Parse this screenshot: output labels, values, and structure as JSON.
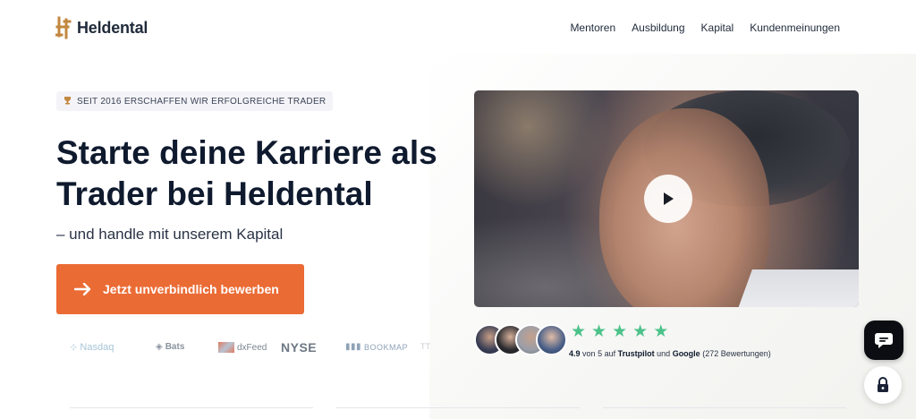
{
  "brand": {
    "name": "Heldental",
    "accent": "#eb6b34",
    "logo_color": "#c2873f"
  },
  "nav": {
    "items": [
      {
        "label": "Mentoren"
      },
      {
        "label": "Ausbildung"
      },
      {
        "label": "Kapital"
      },
      {
        "label": "Kundenmeinungen"
      }
    ]
  },
  "hero": {
    "badge_icon": "trophy-icon",
    "badge_text": "SEIT 2016 ERSCHAFFEN WIR ERFOLGREICHE TRADER",
    "title": "Starte deine Karriere als Trader bei Heldental",
    "subtitle": "– und handle mit unserem Kapital",
    "cta_label": "Jetzt unverbindlich bewerben",
    "cta_icon": "arrow-right-icon"
  },
  "partners": [
    {
      "name": "Nasdaq"
    },
    {
      "name": "Bats"
    },
    {
      "name": "dxFeed"
    },
    {
      "name": "NYSE"
    },
    {
      "name": "BOOKMAP"
    },
    {
      "name": "TT"
    }
  ],
  "video": {
    "play_icon": "play-icon"
  },
  "reviews": {
    "stars": 5,
    "star_color": "#4cc28a",
    "score": "4.9",
    "text_von": "von",
    "max": "5",
    "text_auf": "auf",
    "source1": "Trustpilot",
    "text_und": "und",
    "source2": "Google",
    "count_text": "(272 Bewertungen)"
  },
  "widgets": {
    "chat_icon": "chat-bubble-icon",
    "lock_icon": "lock-icon"
  }
}
